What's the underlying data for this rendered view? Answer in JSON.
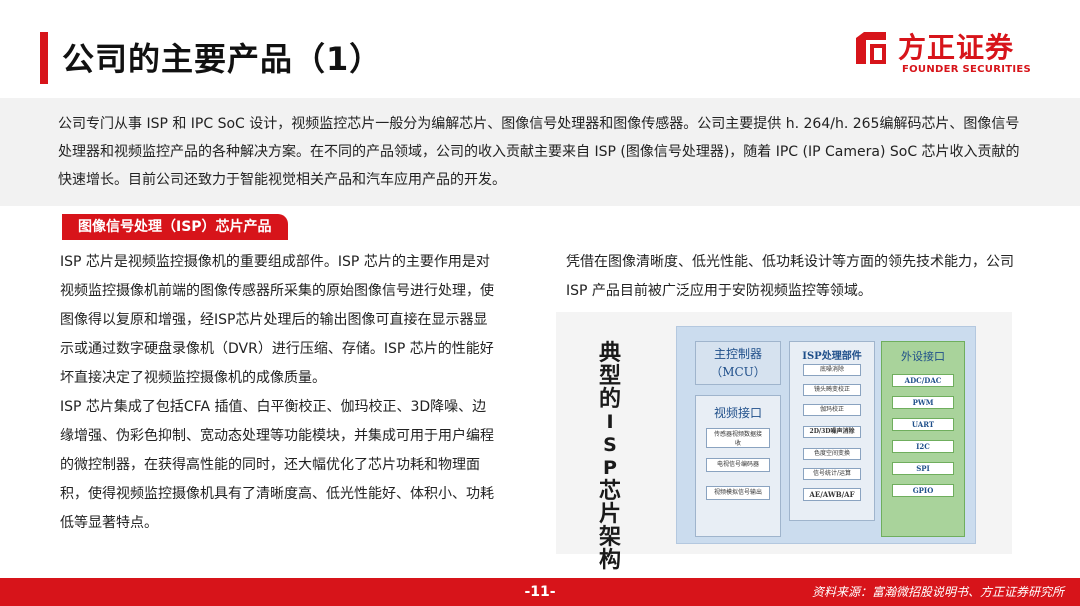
{
  "header": {
    "title": "公司的主要产品（1）",
    "logo_cn": "方正证券",
    "logo_en": "FOUNDER SECURITIES",
    "accent_color": "#d7141a"
  },
  "intro": {
    "text": "公司专门从事 ISP 和 IPC SoC 设计，视频监控芯片一般分为编解芯片、图像信号处理器和图像传感器。公司主要提供 h. 264/h. 265编解码芯片、图像信号处理器和视频监控产品的各种解决方案。在不同的产品领域，公司的收入贡献主要来自 ISP (图像信号处理器)，随着 IPC (IP Camera) SoC 芯片收入贡献的快速增长。目前公司还致力于智能视觉相关产品和汽车应用产品的开发。"
  },
  "section": {
    "label": "图像信号处理（ISP）芯片产品"
  },
  "left": {
    "p1": "ISP 芯片是视频监控摄像机的重要组成部件。ISP 芯片的主要作用是对视频监控摄像机前端的图像传感器所采集的原始图像信号进行处理，使图像得以复原和增强，经ISP芯片处理后的输出图像可直接在显示器显示或通过数字硬盘录像机（DVR）进行压缩、存储。ISP 芯片的性能好坏直接决定了视频监控摄像机的成像质量。",
    "p2": "ISP 芯片集成了包括CFA 插值、白平衡校正、伽玛校正、3D降噪、边缘增强、伪彩色抑制、宽动态处理等功能模块，并集成可用于用户编程的微控制器，在获得高性能的同时，还大幅优化了芯片功耗和物理面积，使得视频监控摄像机具有了清晰度高、低光性能好、体积小、功耗低等显著特点。"
  },
  "right": {
    "text": "凭借在图像清晰度、低光性能、低功耗设计等方面的领先技术能力，公司ISP 产品目前被广泛应用于安防视频监控等领域。"
  },
  "diagram": {
    "vertical_label": [
      "典",
      "型",
      "的",
      "I",
      "S",
      "P",
      "芯",
      "片",
      "架",
      "构"
    ],
    "mcu_line1": "主控制器",
    "mcu_line2": "（MCU）",
    "video_title": "视频接口",
    "video_items": [
      "传感器视频数据接收",
      "电视信号编码器",
      "视频模拟信号输出"
    ],
    "isp_title": "ISP处理部件",
    "isp_items": [
      "底噪消除",
      "镜头畸变校正",
      "伽玛校正",
      "2D/3D噪声消除",
      "色度空间变换",
      "信号统计/运算",
      "AE/AWB/AF"
    ],
    "periph_title": "外设接口",
    "periph_items": [
      "ADC/DAC",
      "PWM",
      "UART",
      "I2C",
      "SPI",
      "GPIO"
    ]
  },
  "footer": {
    "page_number": "-11-",
    "source": "资料来源：富瀚微招股说明书、方正证券研究所"
  }
}
